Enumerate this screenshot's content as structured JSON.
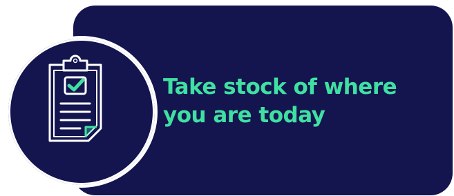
{
  "headline": {
    "line1": "Take stock of where",
    "line2": "you are today"
  },
  "icon": {
    "name": "clipboard-check-icon"
  },
  "colors": {
    "card_background": "#14144f",
    "accent": "#3fe0a1",
    "outline": "#ffffff",
    "page_background": "#ffffff"
  }
}
